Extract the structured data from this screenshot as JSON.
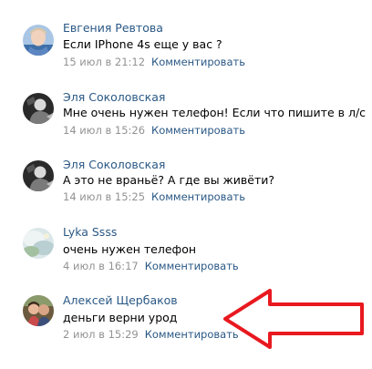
{
  "comments": [
    {
      "author": "Евгения Ревтова",
      "text": "Если IPhone 4s еще у вас ?",
      "date": "15 июл в 21:12",
      "reply": "Комментировать",
      "avatar": "avatar-photo-girl"
    },
    {
      "author": "Эля Соколовская",
      "text": "Мне очень нужен телефон! Если что пишите в л/с",
      "date": "14 июл в 15:26",
      "reply": "Комментировать",
      "avatar": "avatar-photo-bw"
    },
    {
      "author": "Эля Соколовская",
      "text": "А это не враньё? А где вы живёти?",
      "date": "14 июл в 15:25",
      "reply": "Комментировать",
      "avatar": "avatar-photo-bw"
    },
    {
      "author": "Lyka Ssss",
      "text": "очень нужен телефон",
      "date": "4 июл в 16:17",
      "reply": "Комментировать",
      "avatar": "avatar-photo-landscape"
    },
    {
      "author": "Алексей Щербаков",
      "text": "деньги верни урод",
      "date": "2 июл в 15:29",
      "reply": "Комментировать",
      "avatar": "avatar-photo-couple"
    }
  ],
  "annotation": {
    "arrow_color": "#e8191f",
    "arrow_icon": "arrow-left-icon"
  },
  "colors": {
    "link": "#2a5885",
    "date": "#939393",
    "text": "#000000"
  }
}
